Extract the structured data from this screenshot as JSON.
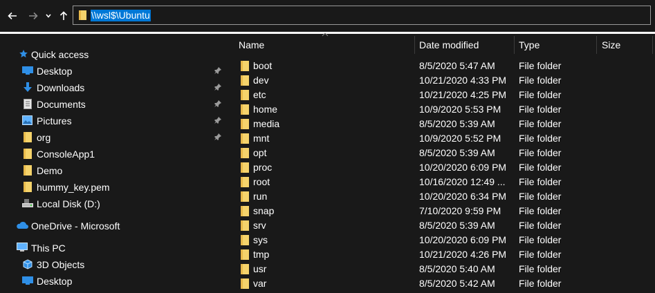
{
  "address_bar": {
    "path": "\\\\wsl$\\Ubuntu"
  },
  "toolbar": {
    "back_icon": "arrow-left-icon",
    "forward_icon": "arrow-right-icon",
    "recent_icon": "chevron-down-icon",
    "up_icon": "arrow-up-icon"
  },
  "nav_pane": {
    "quick_access": {
      "label": "Quick access",
      "items": [
        {
          "label": "Desktop",
          "icon": "desktop-icon",
          "pinned": true
        },
        {
          "label": "Downloads",
          "icon": "download-icon",
          "pinned": true
        },
        {
          "label": "Documents",
          "icon": "document-icon",
          "pinned": true
        },
        {
          "label": "Pictures",
          "icon": "pictures-icon",
          "pinned": true
        },
        {
          "label": "org",
          "icon": "folder-icon",
          "pinned": true
        },
        {
          "label": "ConsoleApp1",
          "icon": "folder-icon",
          "pinned": false
        },
        {
          "label": "Demo",
          "icon": "folder-icon",
          "pinned": false
        },
        {
          "label": "hummy_key.pem",
          "icon": "folder-icon",
          "pinned": false
        },
        {
          "label": "Local Disk (D:)",
          "icon": "drive-icon",
          "pinned": false
        }
      ]
    },
    "onedrive": {
      "label": "OneDrive - Microsoft"
    },
    "this_pc": {
      "label": "This PC",
      "items": [
        {
          "label": "3D Objects",
          "icon": "cube-icon"
        },
        {
          "label": "Desktop",
          "icon": "desktop-icon"
        }
      ]
    }
  },
  "file_list": {
    "columns": [
      "Name",
      "Date modified",
      "Type",
      "Size"
    ],
    "rows": [
      {
        "name": "boot",
        "date": "8/5/2020 5:47 AM",
        "type": "File folder"
      },
      {
        "name": "dev",
        "date": "10/21/2020 4:33 PM",
        "type": "File folder"
      },
      {
        "name": "etc",
        "date": "10/21/2020 4:25 PM",
        "type": "File folder"
      },
      {
        "name": "home",
        "date": "10/9/2020 5:53 PM",
        "type": "File folder"
      },
      {
        "name": "media",
        "date": "8/5/2020 5:39 AM",
        "type": "File folder"
      },
      {
        "name": "mnt",
        "date": "10/9/2020 5:52 PM",
        "type": "File folder"
      },
      {
        "name": "opt",
        "date": "8/5/2020 5:39 AM",
        "type": "File folder"
      },
      {
        "name": "proc",
        "date": "10/20/2020 6:09 PM",
        "type": "File folder"
      },
      {
        "name": "root",
        "date": "10/16/2020 12:49 ...",
        "type": "File folder"
      },
      {
        "name": "run",
        "date": "10/20/2020 6:34 PM",
        "type": "File folder"
      },
      {
        "name": "snap",
        "date": "7/10/2020 9:59 PM",
        "type": "File folder"
      },
      {
        "name": "srv",
        "date": "8/5/2020 5:39 AM",
        "type": "File folder"
      },
      {
        "name": "sys",
        "date": "10/20/2020 6:09 PM",
        "type": "File folder"
      },
      {
        "name": "tmp",
        "date": "10/21/2020 4:26 PM",
        "type": "File folder"
      },
      {
        "name": "usr",
        "date": "8/5/2020 5:40 AM",
        "type": "File folder"
      },
      {
        "name": "var",
        "date": "8/5/2020 5:42 AM",
        "type": "File folder"
      }
    ]
  },
  "colors": {
    "background": "#191919",
    "selection": "#0078d7",
    "folder": "#f5d36b",
    "accent_blue": "#2f8fe6"
  }
}
